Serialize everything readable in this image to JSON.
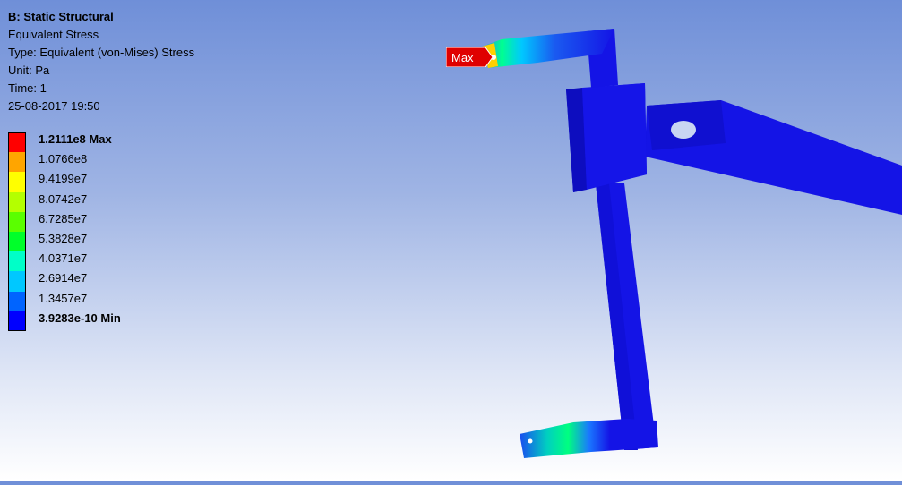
{
  "header": {
    "analysis": "B: Static Structural",
    "result": "Equivalent Stress",
    "type": "Type: Equivalent (von-Mises) Stress",
    "unit": "Unit: Pa",
    "time": "Time: 1",
    "datetime": "25-08-2017 19:50"
  },
  "legend": {
    "entries": [
      {
        "label": "1.2111e8 Max",
        "color": "#ff0000",
        "bold": true
      },
      {
        "label": "1.0766e8",
        "color": "#ffa500",
        "bold": false
      },
      {
        "label": "9.4199e7",
        "color": "#ffff00",
        "bold": false
      },
      {
        "label": "8.0742e7",
        "color": "#b4ff00",
        "bold": false
      },
      {
        "label": "6.7285e7",
        "color": "#5aff00",
        "bold": false
      },
      {
        "label": "5.3828e7",
        "color": "#00ff2a",
        "bold": false
      },
      {
        "label": "4.0371e7",
        "color": "#00ffc8",
        "bold": false
      },
      {
        "label": "2.6914e7",
        "color": "#00c8ff",
        "bold": false
      },
      {
        "label": "1.3457e7",
        "color": "#0064ff",
        "bold": false
      },
      {
        "label": "3.9283e-10 Min",
        "color": "#0000ff",
        "bold": true
      }
    ]
  },
  "probe": {
    "label": "Max",
    "color": "#e00000"
  },
  "model": {
    "base_color": "#1414e6",
    "dark_color": "#0a0aa8"
  }
}
